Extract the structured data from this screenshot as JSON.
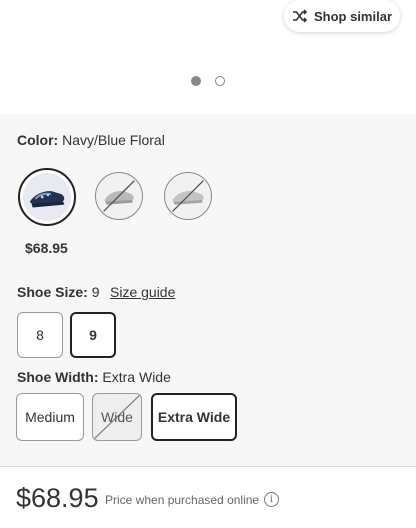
{
  "header": {
    "shop_similar_label": "Shop similar",
    "shop_similar_icon": "shuffle-icon",
    "carousel": {
      "count": 2,
      "active_index": 0
    }
  },
  "color": {
    "label": "Color:",
    "value": "Navy/Blue Floral",
    "swatches": [
      {
        "name": "Navy/Blue Floral",
        "selected": true,
        "available": true
      },
      {
        "name": "",
        "selected": false,
        "available": false
      },
      {
        "name": "",
        "selected": false,
        "available": false
      }
    ],
    "price": "$68.95"
  },
  "size": {
    "label": "Shoe Size:",
    "value": "9",
    "guide_label": "Size guide",
    "options": [
      {
        "label": "8",
        "selected": false
      },
      {
        "label": "9",
        "selected": true
      }
    ]
  },
  "width": {
    "label": "Shoe Width:",
    "value": "Extra Wide",
    "options": [
      {
        "label": "Medium",
        "selected": false,
        "available": true
      },
      {
        "label": "Wide",
        "selected": false,
        "available": false
      },
      {
        "label": "Extra Wide",
        "selected": true,
        "available": true
      }
    ]
  },
  "footer": {
    "price": "$68.95",
    "price_note": "Price when purchased online",
    "info_icon": "info-icon",
    "info_glyph": "i"
  },
  "colors": {
    "selected_border": "#222222",
    "options_background": "#f7f7f7",
    "text": "#333333"
  }
}
